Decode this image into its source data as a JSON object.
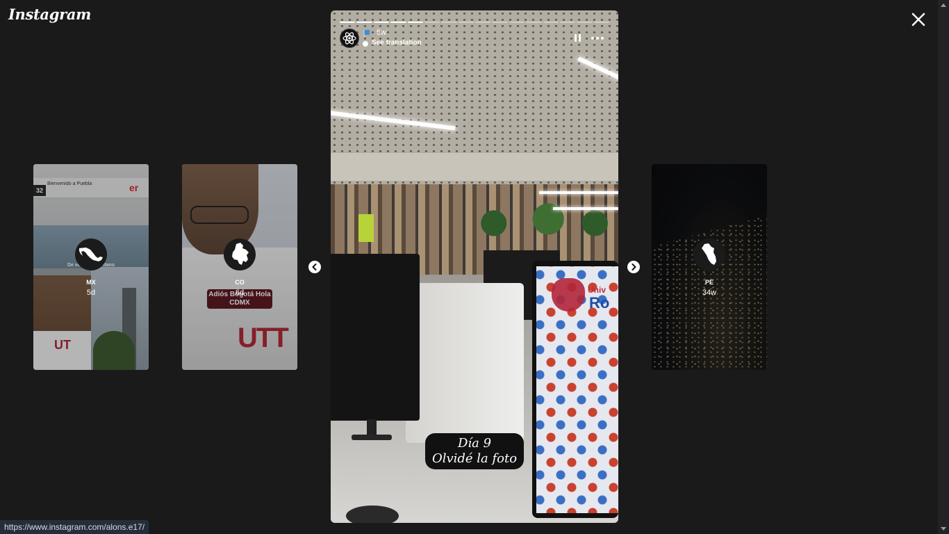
{
  "app": {
    "logo_text": "Instagram"
  },
  "close_label": "Close",
  "story": {
    "time": "5w",
    "translation_label": "See translation",
    "caption_line1": "Día 9",
    "caption_line2": "Olvidé la foto",
    "segments_total": 16,
    "segments_done": 5
  },
  "preview_cards": [
    {
      "username": "MX",
      "time": "5d",
      "caption": "De vuelta al pantano",
      "icon": "mexico-map-icon"
    },
    {
      "username": "CO",
      "time": "6d",
      "caption": "Adiós Bogotá Hola CDMX",
      "icon": "colombia-map-icon"
    },
    {
      "username": "PE",
      "time": "34w",
      "icon": "peru-map-icon"
    }
  ],
  "mx_scene": {
    "sign_text": "Bienvenido a Puebla",
    "platform_number": "32",
    "brand_text": "er"
  },
  "story_scene": {
    "screen_text_1": "Univ",
    "screen_text_2": "Ro"
  },
  "status_bar_url": "https://www.instagram.com/alons.e17/",
  "colors": {
    "background": "#1a1a1a",
    "accent_red": "#b3263a"
  }
}
